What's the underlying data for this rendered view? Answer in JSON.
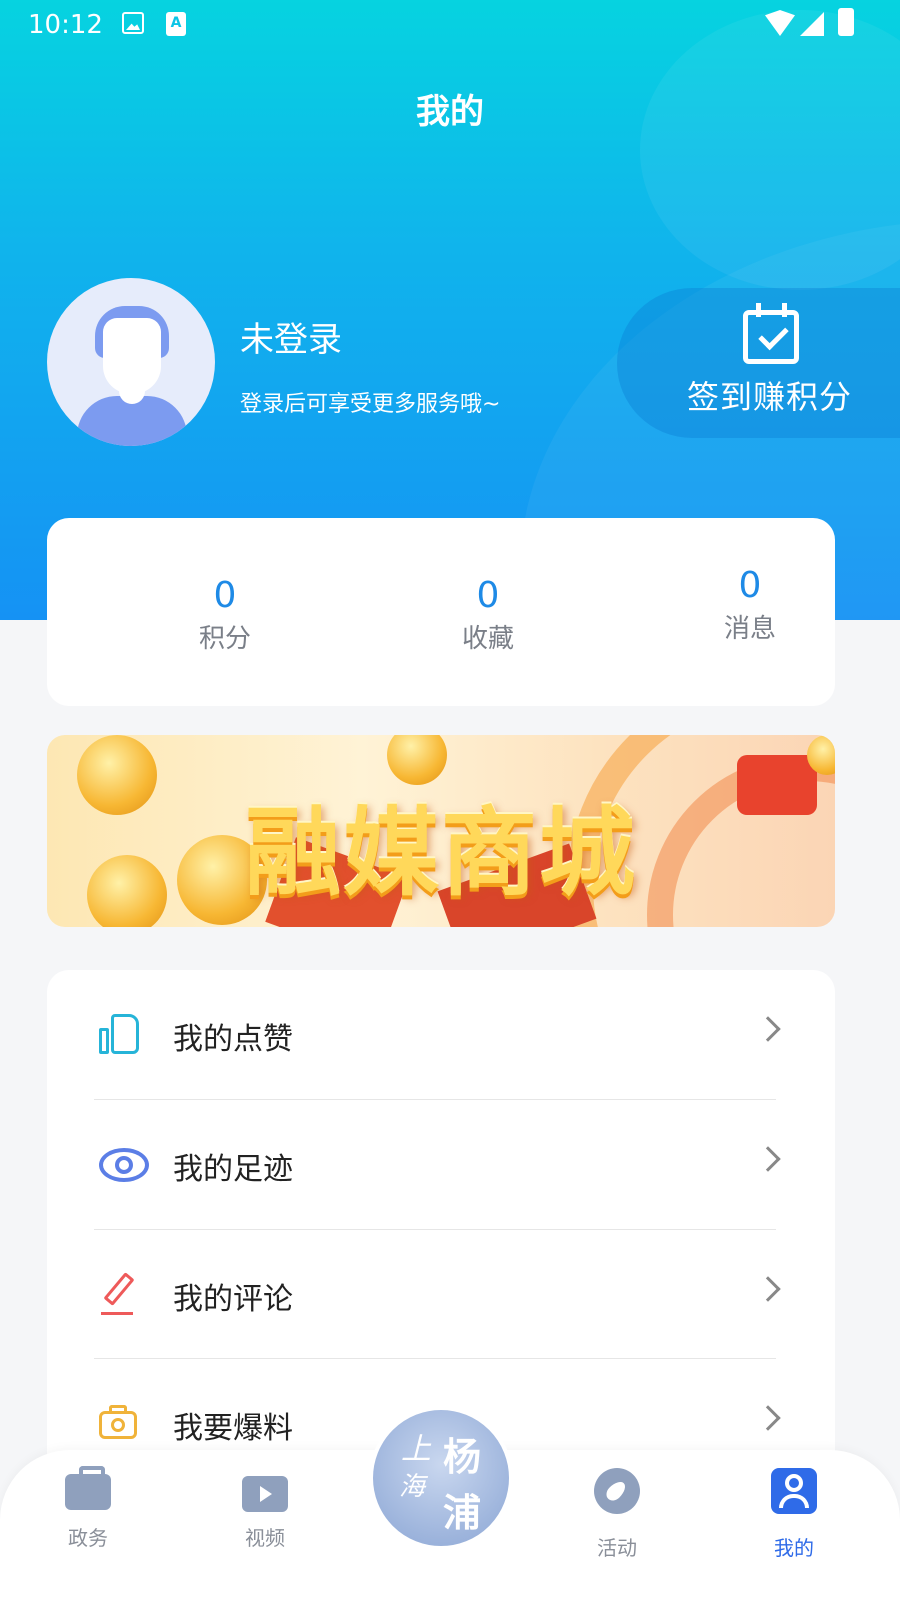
{
  "status_bar": {
    "time": "10:12",
    "a_icon": "A"
  },
  "header": {
    "title": "我的"
  },
  "profile": {
    "name": "未登录",
    "subtitle": "登录后可享受更多服务哦~"
  },
  "signin": {
    "label": "签到赚积分",
    "icon": "calendar-check-icon"
  },
  "stats": [
    {
      "value": "0",
      "label": "积分"
    },
    {
      "value": "0",
      "label": "收藏"
    },
    {
      "value": "0",
      "label": "消息"
    }
  ],
  "banner": {
    "text": "融媒商城"
  },
  "menu": [
    {
      "label": "我的点赞",
      "icon": "thumbs-up-icon"
    },
    {
      "label": "我的足迹",
      "icon": "eye-icon"
    },
    {
      "label": "我的评论",
      "icon": "pen-icon"
    },
    {
      "label": "我要爆料",
      "icon": "camera-icon"
    }
  ],
  "tabbar": {
    "items": [
      {
        "label": "政务",
        "icon": "briefcase-icon"
      },
      {
        "label": "视频",
        "icon": "tv-icon"
      },
      {
        "label": "活动",
        "icon": "compass-icon"
      },
      {
        "label": "我的",
        "icon": "user-icon",
        "active": true
      }
    ],
    "center_logo": {
      "line1": "上",
      "line2": "海",
      "line3": "杨",
      "line4": "浦"
    }
  },
  "colors": {
    "accent": "#1e8ae6",
    "active_tab": "#2f6be8",
    "header_top": "#06d3e0",
    "header_bottom": "#1592f4"
  }
}
